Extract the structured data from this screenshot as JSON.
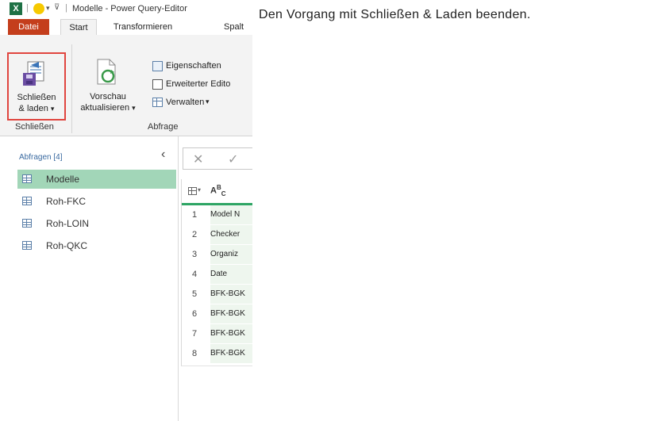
{
  "titlebar": {
    "app_icon": "excel-icon",
    "app_letter": "X",
    "smiley": "smiley-icon",
    "separator": "|",
    "title": "Modelle - Power Query-Editor"
  },
  "tabs": [
    {
      "label": "Datei"
    },
    {
      "label": "Start"
    },
    {
      "label": "Transformieren"
    },
    {
      "label": "Spalt"
    }
  ],
  "ribbon": {
    "close_load": {
      "line1": "Schließen",
      "line2": "& laden",
      "arrow": "▾",
      "icon": "close-and-load-icon"
    },
    "group_close_label": "Schließen",
    "preview": {
      "line1": "Vorschau",
      "line2": "aktualisieren",
      "arrow": "▾",
      "icon": "refresh-preview-icon"
    },
    "properties": "Eigenschaften",
    "advanced_editor": "Erweiterter Edito",
    "manage": "Verwalten",
    "manage_arrow": "▾",
    "group_query_label": "Abfrage"
  },
  "queries": {
    "header": "Abfragen [4]",
    "collapse_glyph": "‹",
    "items": [
      {
        "label": "Modelle",
        "selected": true
      },
      {
        "label": "Roh-FKC",
        "selected": false
      },
      {
        "label": "Roh-LOIN",
        "selected": false
      },
      {
        "label": "Roh-QKC",
        "selected": false
      }
    ]
  },
  "formula_bar": {
    "cancel": "✕",
    "confirm": "✓"
  },
  "grid": {
    "column_type": "ABC",
    "rows": [
      {
        "num": "1",
        "value": "Model N"
      },
      {
        "num": "2",
        "value": "Checker"
      },
      {
        "num": "3",
        "value": "Organiz"
      },
      {
        "num": "4",
        "value": "Date"
      },
      {
        "num": "5",
        "value": "BFK-BGK"
      },
      {
        "num": "6",
        "value": "BFK-BGK"
      },
      {
        "num": "7",
        "value": "BFK-BGK"
      },
      {
        "num": "8",
        "value": "BFK-BGK"
      }
    ]
  },
  "instruction": "Den Vorgang mit Schließen & Laden beenden.",
  "colors": {
    "accent_red": "#c43e1c",
    "highlight": "#e0453f",
    "selected_query": "#a2d6b8",
    "excel_green": "#1e7145"
  }
}
